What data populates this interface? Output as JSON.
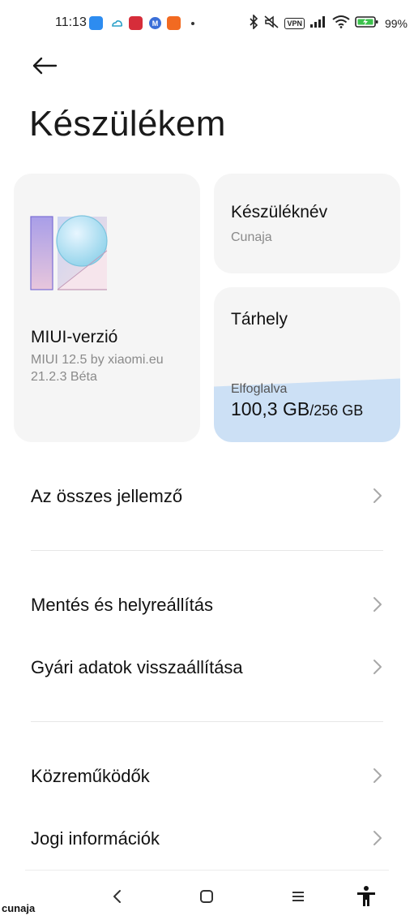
{
  "status_bar": {
    "time": "11:13",
    "battery_percent": "99%",
    "vpn_label": "VPN",
    "notification_icons": [
      "cloud-app-icon",
      "weather-icon",
      "shield-app-icon",
      "m-app-icon",
      "mi-app-icon"
    ],
    "system_icons": [
      "bluetooth-icon",
      "mute-icon",
      "vpn-icon",
      "signal-icon",
      "wifi-icon",
      "battery-charging-icon"
    ]
  },
  "header": {
    "back_icon": "arrow-left-icon",
    "title": "Készülékem"
  },
  "cards": {
    "miui": {
      "label": "MIUI-verzió",
      "version_line1": "MIUI 12.5 by xiaomi.eu",
      "version_line2": "21.2.3 Béta",
      "logo_icon": "miui-12-logo-icon"
    },
    "device_name": {
      "label": "Készüléknév",
      "value": "Cunaja"
    },
    "storage": {
      "label": "Tárhely",
      "used_label": "Elfoglalva",
      "used": "100,3 GB",
      "total": "/256 GB",
      "used_fraction": 0.39,
      "fill_color": "#cce0f5"
    }
  },
  "menu": {
    "all_specs": "Az összes jellemző",
    "backup_restore": "Mentés és helyreállítás",
    "factory_reset": "Gyári adatok visszaállítása",
    "contributors": "Közreműködők",
    "legal_info": "Jogi információk",
    "chevron_icon": "chevron-right-icon"
  },
  "nav_bar": {
    "back_icon": "nav-back-icon",
    "home_icon": "nav-home-icon",
    "recents_icon": "nav-recents-icon",
    "accessibility_icon": "accessibility-icon"
  },
  "watermark": "cunaja"
}
